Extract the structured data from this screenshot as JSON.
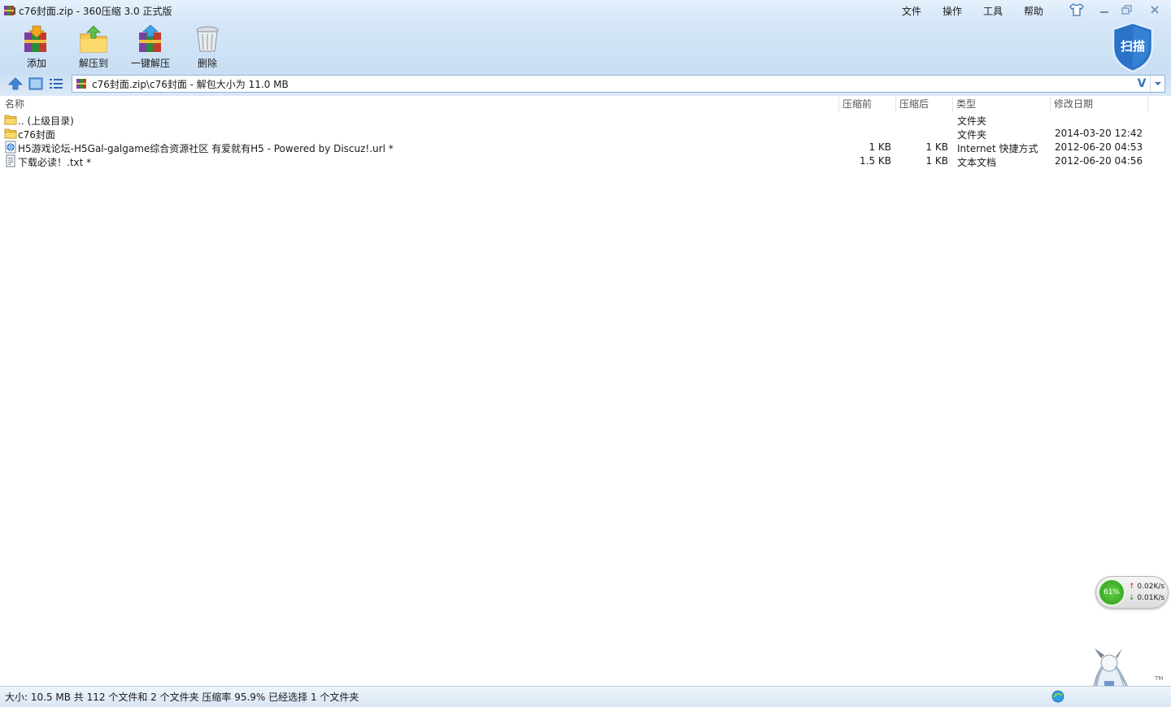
{
  "window": {
    "title": "c76封面.zip - 360压缩 3.0 正式版",
    "menu": [
      "文件",
      "操作",
      "工具",
      "帮助"
    ]
  },
  "toolbar": {
    "add_label": "添加",
    "extract_to_label": "解压到",
    "one_click_label": "一键解压",
    "delete_label": "删除"
  },
  "scan": {
    "label": "扫描"
  },
  "address": {
    "path": "c76封面.zip\\c76封面 - 解包大小为 11.0 MB",
    "v_mark": "V"
  },
  "columns": {
    "name": "名称",
    "before": "压缩前",
    "after": "压缩后",
    "type": "类型",
    "date": "修改日期"
  },
  "files": [
    {
      "icon": "folder-up-icon",
      "name": ".. (上级目录)",
      "before": "",
      "after": "",
      "type": "文件夹",
      "date": ""
    },
    {
      "icon": "folder-icon",
      "name": "c76封面",
      "before": "",
      "after": "",
      "type": "文件夹",
      "date": "2014-03-20 12:42"
    },
    {
      "icon": "url-shortcut-icon",
      "name": "H5游戏论坛-H5Gal-galgame综合资源社区 有爱就有H5 - Powered by Discuz!.url *",
      "before": "1 KB",
      "after": "1 KB",
      "type": "Internet 快捷方式",
      "date": "2012-06-20 04:53"
    },
    {
      "icon": "text-file-icon",
      "name": "下载必读！.txt *",
      "before": "1.5 KB",
      "after": "1 KB",
      "type": "文本文档",
      "date": "2012-06-20 04:56"
    }
  ],
  "speed_widget": {
    "percent": "61%",
    "up": "0.02K/s",
    "down": "0.01K/s"
  },
  "statusbar": {
    "text": "大小: 10.5 MB 共 112 个文件和 2 个文件夹 压缩率 95.9% 已经选择 1 个文件夹"
  },
  "mascot": {
    "tm": "TM"
  },
  "colors": {
    "accent": "#3a74b8",
    "top_bg": "#c9def4",
    "speed_green": "#2e9a1f"
  }
}
